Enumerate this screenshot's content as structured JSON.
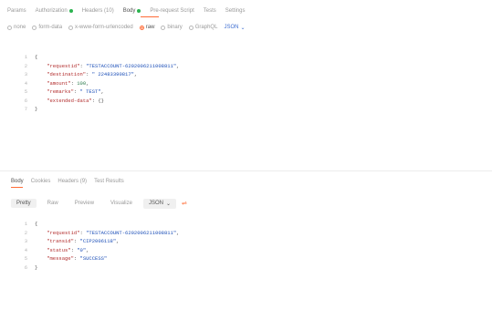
{
  "request_tabs": [
    {
      "label": "Params",
      "dot": null,
      "active": false
    },
    {
      "label": "Authorization",
      "dot": "#2bb34f",
      "active": false
    },
    {
      "label": "Headers (10)",
      "dot": null,
      "active": false
    },
    {
      "label": "Body",
      "dot": "#2bb34f",
      "active": true
    },
    {
      "label": "Pre-request Script",
      "dot": null,
      "active": false
    },
    {
      "label": "Tests",
      "dot": null,
      "active": false
    },
    {
      "label": "Settings",
      "dot": null,
      "active": false
    }
  ],
  "body_types": [
    {
      "label": "none",
      "selected": false
    },
    {
      "label": "form-data",
      "selected": false
    },
    {
      "label": "x-www-form-urlencoded",
      "selected": false
    },
    {
      "label": "raw",
      "selected": true
    },
    {
      "label": "binary",
      "selected": false
    },
    {
      "label": "GraphQL",
      "selected": false
    }
  ],
  "body_format": "JSON",
  "request_body": [
    {
      "num": "1",
      "key": "",
      "value": "",
      "open": "{"
    },
    {
      "num": "2",
      "key": "\"requestid\"",
      "value": "\"TESTACCOUNT-6202006211008811\"",
      "vtype": "s"
    },
    {
      "num": "3",
      "key": "\"destination\"",
      "value": "\" 22483390817\"",
      "vtype": "s"
    },
    {
      "num": "4",
      "key": "\"amount\"",
      "value": "100",
      "vtype": "n"
    },
    {
      "num": "5",
      "key": "\"remarks\"",
      "value": "\" TEST\"",
      "vtype": "s"
    },
    {
      "num": "6",
      "key": "\"extended-data\"",
      "value": "{}",
      "vtype": "p"
    },
    {
      "num": "7",
      "key": "",
      "value": "",
      "open": "}"
    }
  ],
  "response_tabs": [
    {
      "label": "Body",
      "active": true
    },
    {
      "label": "Cookies",
      "active": false
    },
    {
      "label": "Headers (9)",
      "active": false
    },
    {
      "label": "Test Results",
      "active": false
    }
  ],
  "view_modes": [
    {
      "label": "Pretty",
      "active": true
    },
    {
      "label": "Raw",
      "active": false
    },
    {
      "label": "Preview",
      "active": false
    },
    {
      "label": "Visualize",
      "active": false
    }
  ],
  "response_format": "JSON",
  "response_body": [
    {
      "num": "1",
      "key": "",
      "value": "",
      "open": "{"
    },
    {
      "num": "2",
      "key": "\"requestid\"",
      "value": "\"TESTACCOUNT-6202006211008811\"",
      "vtype": "s"
    },
    {
      "num": "3",
      "key": "\"transid\"",
      "value": "\"CIP2006118\"",
      "vtype": "s"
    },
    {
      "num": "4",
      "key": "\"status\"",
      "value": "\"0\"",
      "vtype": "s"
    },
    {
      "num": "5",
      "key": "\"message\"",
      "value": "\"SUCCESS\"",
      "vtype": "s"
    },
    {
      "num": "6",
      "key": "",
      "value": "",
      "open": "}"
    }
  ]
}
